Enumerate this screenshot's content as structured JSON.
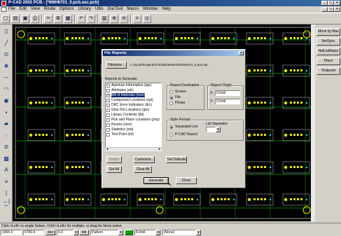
{
  "window": {
    "title": "P-CAD 2002 PCB - [*6MH6701_0.pcb.asc.pcb]"
  },
  "menu": [
    "File",
    "Edit",
    "View",
    "Route",
    "Options",
    "Library",
    "Utils",
    "DocTool",
    "Macro",
    "Window",
    "Help"
  ],
  "toolbar_icons": [
    "new-icon",
    "open-icon",
    "save-icon",
    "print-icon",
    "cut-icon",
    "copy-icon",
    "paste-icon",
    "undo-icon",
    "redo-icon",
    "layer-icon",
    "zoom-in-icon",
    "zoom-out-icon",
    "grid-icon",
    "snap-icon"
  ],
  "left_tools": [
    "select-icon",
    "route-icon",
    "zoom-icon",
    "pan-icon",
    "line-icon",
    "arc-icon",
    "via-icon",
    "pad-icon",
    "copper-icon",
    "cutout-icon",
    "keepout-icon",
    "fill-icon",
    "text-icon",
    "attribute-icon",
    "dimension-icon",
    "measure-icon"
  ],
  "right_panel": [
    "Move by Mac",
    "NetSync",
    "NetListRepor",
    "Place",
    "Testpoint"
  ],
  "status": {
    "hint": "Click <Left> to single Select, <Ctrl><Left> for multiple, or drag for block select.",
    "x": "1965.0",
    "y": "6790.0",
    "rel": "Rel",
    "grid": "5.0",
    "unit": "Mil",
    "layer": "Pattern",
    "width": "8.0mil",
    "net": "(None)"
  },
  "dialog": {
    "title": "File Reports",
    "filename_button": "Filename...",
    "filename": "L:\\Vocal\\Projects\\4701MX\\MX6701\\MX6701_0.pcb.asc",
    "reports_label": "Reports to Generate:",
    "reports": [
      {
        "label": "Aperture Information  (apr)",
        "checked": false,
        "selected": false
      },
      {
        "label": "Attributes  (atr)",
        "checked": false,
        "selected": false
      },
      {
        "label": "Bill of Materials  (bom)",
        "checked": true,
        "selected": true
      },
      {
        "label": "Component Locations  (cpl)",
        "checked": false,
        "selected": false
      },
      {
        "label": "DRC Error Indicators  (drc)",
        "checked": false,
        "selected": false
      },
      {
        "label": "Glue Dot Locations  (glu)",
        "checked": false,
        "selected": false
      },
      {
        "label": "Library Contents  (lbl)",
        "checked": false,
        "selected": false
      },
      {
        "label": "Pick and Place Locations  (pnp)",
        "checked": false,
        "selected": false
      },
      {
        "label": "Rooms  (rom)",
        "checked": false,
        "selected": false
      },
      {
        "label": "Statistics  (sta)",
        "checked": false,
        "selected": false
      },
      {
        "label": "Test Point  (tst)",
        "checked": false,
        "selected": false
      }
    ],
    "destination": {
      "label": "Report Destination",
      "options": [
        "Screen",
        "File",
        "Printer"
      ],
      "selected": "File"
    },
    "origin": {
      "label": "Report Origin",
      "x_label": "X:",
      "x": "0.0mil",
      "y_label": "Y:",
      "y": "0.0mil"
    },
    "style": {
      "label": "Style Format",
      "options": [
        "Separated List",
        "P-CAD Report"
      ],
      "selected": "Separated List"
    },
    "list_separator": {
      "label": "List Separator",
      "value": ","
    },
    "buttons": {
      "delete": "Delete",
      "customize": "Customize...",
      "set_defaults": "Set Defaults",
      "set_all": "Set All",
      "clear_all": "Clear All",
      "generate": "Generate",
      "close": "Close"
    }
  },
  "colors": {
    "canvas": "#000000",
    "pad_yellow": "#e8e800",
    "trace_green": "#00a000",
    "outline_white": "#ffffff",
    "dot_cyan": "#40c0ff"
  }
}
